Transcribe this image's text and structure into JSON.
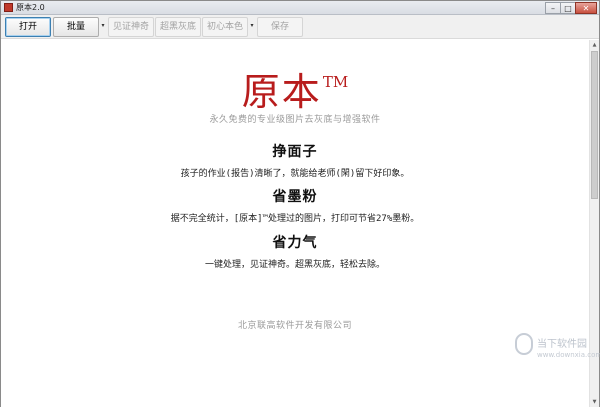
{
  "window": {
    "title": "原本2.0",
    "controls": {
      "minimize": "–",
      "maximize": "□",
      "close": "✕"
    }
  },
  "toolbar": {
    "open_label": "打开",
    "batch_label": "批量",
    "dropdown_glyph": "▾",
    "verify_label": "见证神奇",
    "super_dark_label": "超黑灰底",
    "original_color_label": "初心本色",
    "save_label": "保存"
  },
  "main": {
    "brand_name": "原本",
    "brand_tm": "TM",
    "subtitle": "永久免费的专业级图片去灰底与增强软件",
    "sections": [
      {
        "title": "挣面子",
        "desc": "孩子的作业(报告)清晰了，就能给老师(閑)留下好印象。"
      },
      {
        "title": "省墨粉",
        "desc": "据不完全统计，[原本]™处理过的图片，打印可节省27%墨粉。"
      },
      {
        "title": "省力气",
        "desc": "一键处理，见证神奇。超黑灰底，轻松去除。"
      }
    ],
    "footer": "北京联高软件开发有限公司"
  },
  "scrollbar": {
    "up_glyph": "▲",
    "down_glyph": "▼"
  },
  "watermark": {
    "text": "当下软件园",
    "sub": "www.downxia.com"
  },
  "colors": {
    "brand_red": "#b81c1c",
    "muted_gray": "#9a9a9a"
  }
}
